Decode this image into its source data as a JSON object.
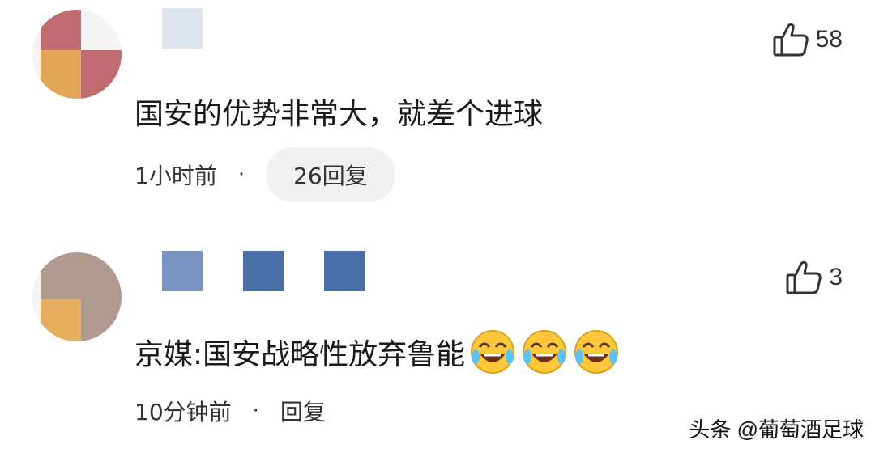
{
  "comments": [
    {
      "likes": "58",
      "text": "国安的优势非常大，就差个进球",
      "time": "1小时前",
      "separator": "·",
      "reply_label": "26回复"
    },
    {
      "likes": "3",
      "text": "京媒:国安战略性放弃鲁能",
      "emoji_icon": "rolling-on-floor-laughing-icon",
      "time": "10分钟前",
      "separator": "·",
      "reply_label": "回复"
    }
  ],
  "watermark": "头条 @葡萄酒足球",
  "colors": {
    "avatar1_red": "#c06a72",
    "avatar1_orange": "#e2a756",
    "avatar2_taupe": "#b09a90",
    "avatar2_orange": "#e6b060",
    "name2_blue": "#4a6ea6",
    "pill_bg": "#f1f1f1"
  }
}
